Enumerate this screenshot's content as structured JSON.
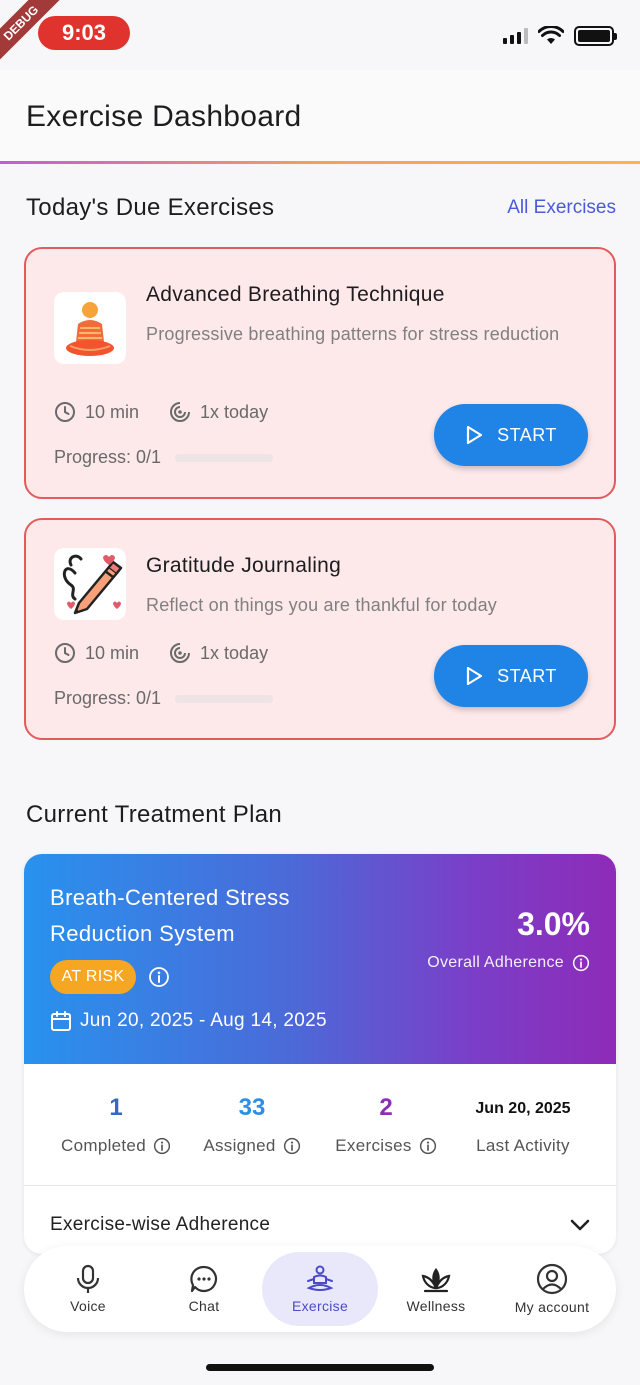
{
  "status_bar": {
    "time": "9:03",
    "ribbon": "DEBUG"
  },
  "header": {
    "title": "Exercise Dashboard"
  },
  "due_section": {
    "title": "Today's Due Exercises",
    "link": "All Exercises"
  },
  "exercises": [
    {
      "title": "Advanced Breathing Technique",
      "description": "Progressive breathing patterns for stress reduction",
      "duration": "10 min",
      "frequency": "1x today",
      "progress_text": "Progress: 0/1",
      "progress": 0,
      "start_label": "START",
      "icon": "meditation-icon"
    },
    {
      "title": "Gratitude Journaling",
      "description": "Reflect on things you are thankful for today",
      "duration": "10 min",
      "frequency": "1x today",
      "progress_text": "Progress: 0/1",
      "progress": 0,
      "start_label": "START",
      "icon": "journal-pencil-icon"
    }
  ],
  "plan_section": {
    "title": "Current Treatment Plan"
  },
  "plan": {
    "name": "Breath-Centered Stress Reduction System",
    "status": "AT RISK",
    "dates": "Jun 20, 2025 - Aug 14, 2025",
    "adherence_value": "3.0%",
    "adherence_label": "Overall Adherence",
    "stats": [
      {
        "value": "1",
        "label": "Completed",
        "color": "#3a66c4"
      },
      {
        "value": "33",
        "label": "Assigned",
        "color": "#2a8fe8"
      },
      {
        "value": "2",
        "label": "Exercises",
        "color": "#8a2fb8"
      },
      {
        "value": "Jun 20, 2025",
        "label": "Last Activity",
        "color": "#111111"
      }
    ],
    "exercise_adherence_label": "Exercise-wise Adherence"
  },
  "nav": {
    "items": [
      {
        "label": "Voice",
        "icon": "microphone-icon"
      },
      {
        "label": "Chat",
        "icon": "chat-bubble-icon"
      },
      {
        "label": "Exercise",
        "icon": "meditation-icon"
      },
      {
        "label": "Wellness",
        "icon": "lotus-icon"
      },
      {
        "label": "My account",
        "icon": "account-icon"
      }
    ],
    "active": "Exercise"
  }
}
